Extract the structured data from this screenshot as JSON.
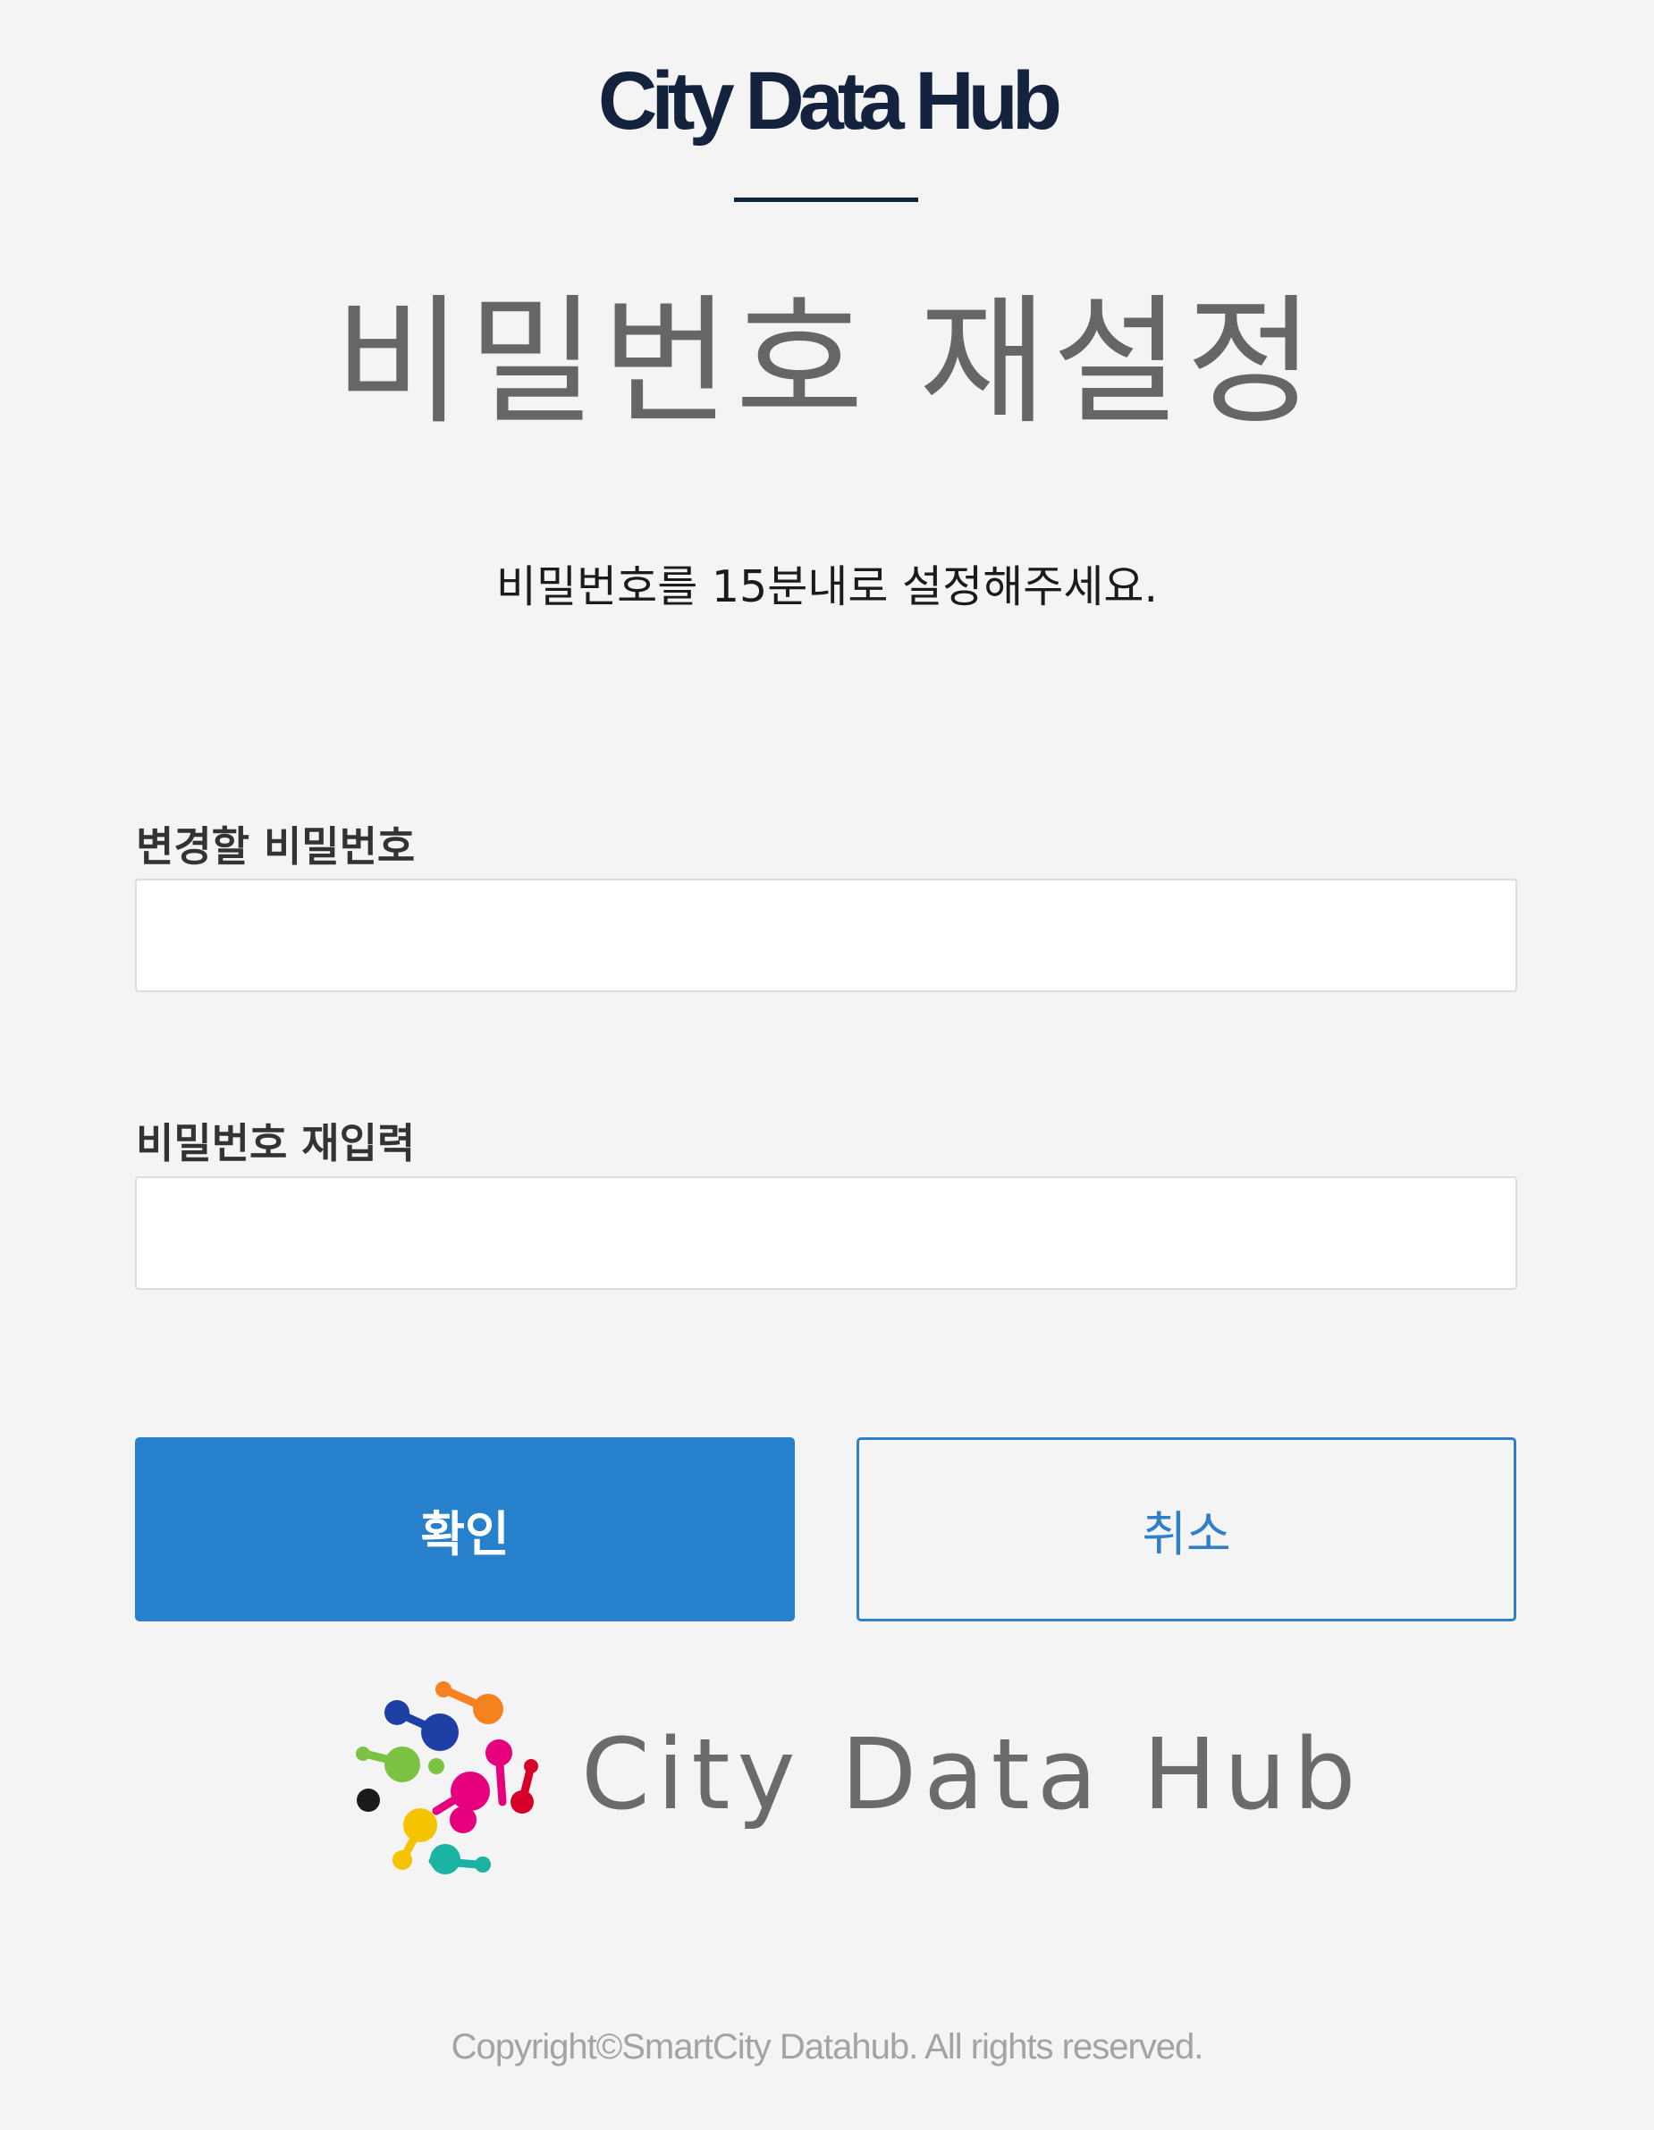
{
  "header": {
    "brand": "City Data Hub"
  },
  "page": {
    "title": "비밀번호 재설정",
    "instruction": "비밀번호를 15분내로 설정해주세요."
  },
  "form": {
    "new_password_label": "변경할 비밀번호",
    "new_password_value": "",
    "confirm_password_label": "비밀번호 재입력",
    "confirm_password_value": ""
  },
  "buttons": {
    "confirm_label": "확인",
    "cancel_label": "취소"
  },
  "logo": {
    "text": "City Data Hub",
    "icon": "molecule-dots-icon"
  },
  "footer": {
    "copyright": "Copyright©SmartCity Datahub. All rights reserved."
  },
  "colors": {
    "brand_navy": "#14233d",
    "primary_blue": "#2680cc",
    "background": "#f4f4f4",
    "title_gray": "#666666"
  }
}
